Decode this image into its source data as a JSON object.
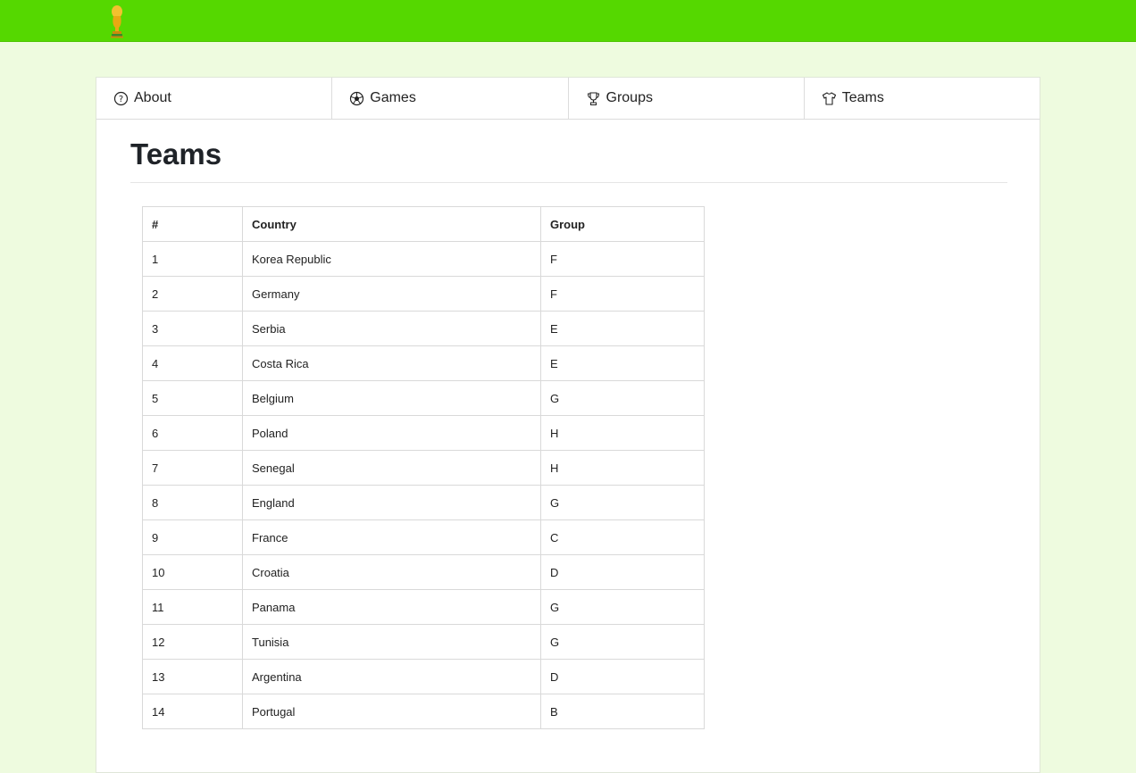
{
  "header": {
    "logo_icon": "trophy-icon"
  },
  "nav": [
    {
      "label": "About",
      "icon": "question-circle-icon"
    },
    {
      "label": "Games",
      "icon": "soccer-ball-icon"
    },
    {
      "label": "Groups",
      "icon": "trophy-icon"
    },
    {
      "label": "Teams",
      "icon": "tshirt-icon"
    }
  ],
  "page": {
    "title": "Teams"
  },
  "table": {
    "headers": [
      "#",
      "Country",
      "Group"
    ],
    "rows": [
      [
        "1",
        "Korea Republic",
        "F"
      ],
      [
        "2",
        "Germany",
        "F"
      ],
      [
        "3",
        "Serbia",
        "E"
      ],
      [
        "4",
        "Costa Rica",
        "E"
      ],
      [
        "5",
        "Belgium",
        "G"
      ],
      [
        "6",
        "Poland",
        "H"
      ],
      [
        "7",
        "Senegal",
        "H"
      ],
      [
        "8",
        "England",
        "G"
      ],
      [
        "9",
        "France",
        "C"
      ],
      [
        "10",
        "Croatia",
        "D"
      ],
      [
        "11",
        "Panama",
        "G"
      ],
      [
        "12",
        "Tunisia",
        "G"
      ],
      [
        "13",
        "Argentina",
        "D"
      ],
      [
        "14",
        "Portugal",
        "B"
      ]
    ]
  },
  "colors": {
    "header_bg": "#55d800",
    "page_bg": "#eefbdf",
    "trophy": "#e8b21a"
  }
}
